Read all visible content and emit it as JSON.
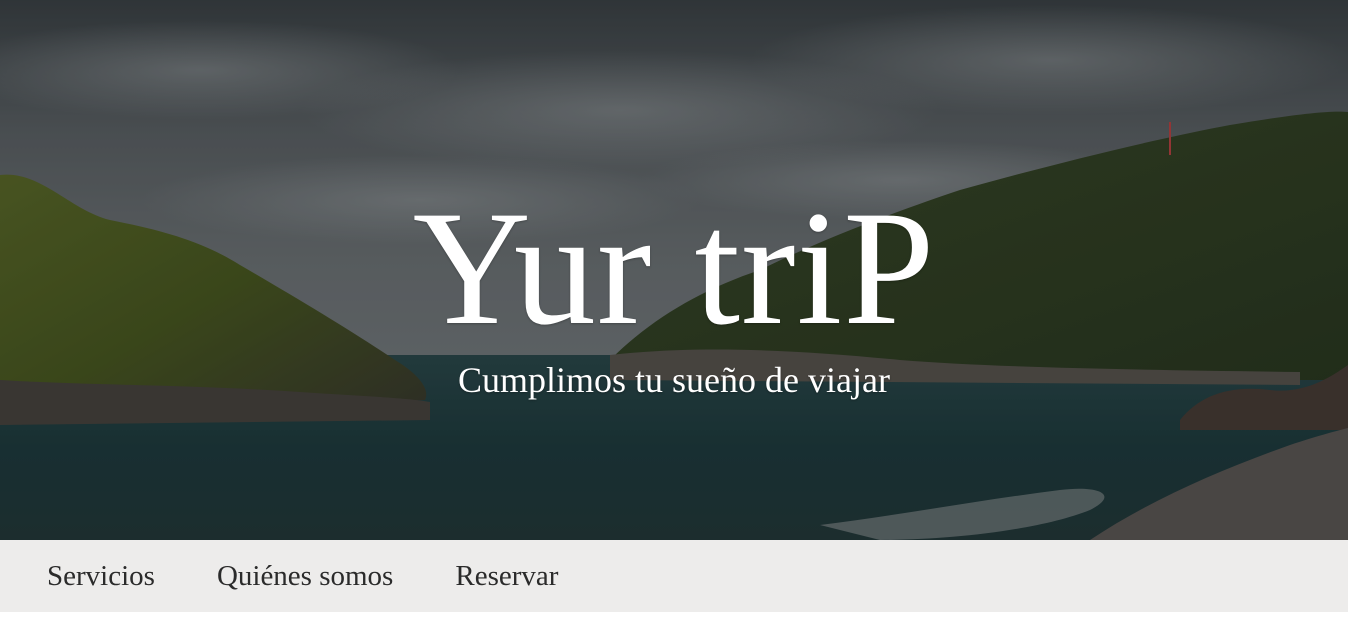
{
  "hero": {
    "title": "Yur triP",
    "subtitle": "Cumplimos tu sueño de viajar",
    "background_image": "coastal-bay-landscape"
  },
  "nav": {
    "items": [
      {
        "label": "Servicios"
      },
      {
        "label": "Quiénes somos"
      },
      {
        "label": "Reservar"
      }
    ]
  },
  "colors": {
    "nav_background": "#edeceb",
    "nav_text": "#2b2b2b",
    "hero_text": "#ffffff"
  }
}
